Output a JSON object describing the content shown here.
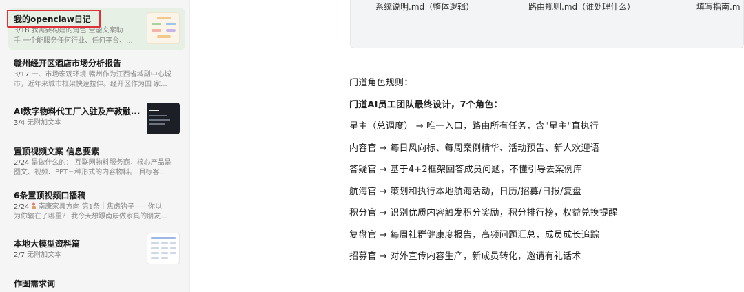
{
  "sidebar": {
    "notes": [
      {
        "title": "我的openclaw日记",
        "date": "3/18",
        "snippet": "我需要构建的角色 全能文案助",
        "snippet2": "手 一个能服务任何行业、任何平台、...",
        "thumbnail": "flowchart-thumbnail",
        "active": true
      },
      {
        "title": "赣州经开区酒店市场分析报告",
        "date": "3/17",
        "snippet": "一、市场宏观环境 赣州作为江西省域副中心城",
        "snippet2": "市，近年来城市框架快速拉伸。经开区作为国 家...",
        "active": false
      },
      {
        "title": "AI数字物料代工厂入驻及产教融...",
        "date": "3/4",
        "snippet": "无附加文本",
        "thumbnail": "dark-slide-thumbnail",
        "active": false
      },
      {
        "title": "置顶视频文案 信息要素",
        "date": "2/24",
        "snippet": "是做什么的：  互联网物料服务商，核心产品是",
        "snippet2": "图文、视频、PPT三种形式的内容物料。 目标客...",
        "active": false
      },
      {
        "title": "6条置顶视频口播稿",
        "date": "2/24",
        "snippet": "南康家具方向 第1条｜焦虑钩子——你以",
        "snippet2": "为你输在了哪里？ 我今天想跟南康做家具的朋友...",
        "icon": "people-icon",
        "active": false
      },
      {
        "title": "本地大模型资料篇",
        "date": "2/7",
        "snippet": "无附加文本",
        "thumbnail": "table-thumbnail",
        "active": false
      },
      {
        "title": "作图需求词",
        "date": "",
        "snippet": "",
        "active": false
      }
    ],
    "highlight_color": "#e0313a",
    "active_bg": "#e6f0e4"
  },
  "attachments": [
    {
      "label": "系统说明.md（整体逻辑）"
    },
    {
      "label": "路由规则.md（谁处理什么）"
    },
    {
      "label": "填写指南.m"
    }
  ],
  "document": {
    "paragraphs": [
      {
        "text": "门道角色规则：",
        "bold": false
      },
      {
        "text": "门道AI员工团队最终设计，7个角色：",
        "bold": true
      },
      {
        "text": "星主（总调度） → 唯一入口，路由所有任务，含\"星主\"直执行",
        "bold": false
      },
      {
        "text": "内容官 → 每日风向标、每周案例精华、活动预告、新人欢迎语",
        "bold": false
      },
      {
        "text": "答疑官 → 基于4+2框架回答成员问题，不懂引导去案例库",
        "bold": false
      },
      {
        "text": "航海官 → 策划和执行本地航海活动，日历/招募/日报/复盘",
        "bold": false
      },
      {
        "text": "积分官 → 识别优质内容触发积分奖励，积分排行榜，权益兑换提醒",
        "bold": false
      },
      {
        "text": "复盘官 → 每周社群健康度报告，高频问题汇总，成员成长追踪",
        "bold": false
      },
      {
        "text": "招募官 → 对外宣传内容生产，新成员转化，邀请有礼话术",
        "bold": false
      }
    ]
  }
}
